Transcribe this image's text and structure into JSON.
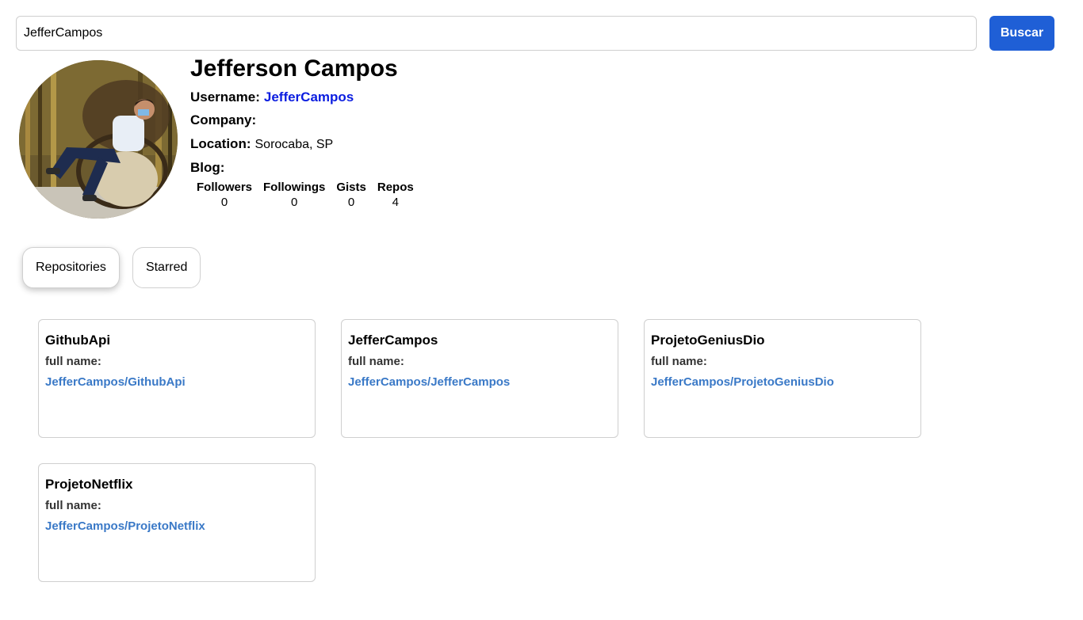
{
  "search": {
    "value": "JefferCampos",
    "button_label": "Buscar"
  },
  "profile": {
    "name": "Jefferson Campos",
    "username_label": "Username:",
    "username": "JefferCampos",
    "company_label": "Company:",
    "company": "",
    "location_label": "Location:",
    "location": "Sorocaba, SP",
    "blog_label": "Blog:",
    "blog": ""
  },
  "stats": [
    {
      "label": "Followers",
      "value": "0"
    },
    {
      "label": "Followings",
      "value": "0"
    },
    {
      "label": "Gists",
      "value": "0"
    },
    {
      "label": "Repos",
      "value": "4"
    }
  ],
  "tabs": [
    {
      "label": "Repositories",
      "active": true
    },
    {
      "label": "Starred",
      "active": false
    }
  ],
  "repos": [
    {
      "name": "GithubApi",
      "full_name_label": "full name:",
      "full_name": "JefferCampos/GithubApi"
    },
    {
      "name": "JefferCampos",
      "full_name_label": "full name:",
      "full_name": "JefferCampos/JefferCampos"
    },
    {
      "name": "ProjetoGeniusDio",
      "full_name_label": "full name:",
      "full_name": "JefferCampos/ProjetoGeniusDio"
    },
    {
      "name": "ProjetoNetflix",
      "full_name_label": "full name:",
      "full_name": "JefferCampos/ProjetoNetflix"
    }
  ],
  "colors": {
    "accent": "#1f5fd6",
    "username_link": "#0b1de0",
    "repo_link": "#3a79c7"
  }
}
